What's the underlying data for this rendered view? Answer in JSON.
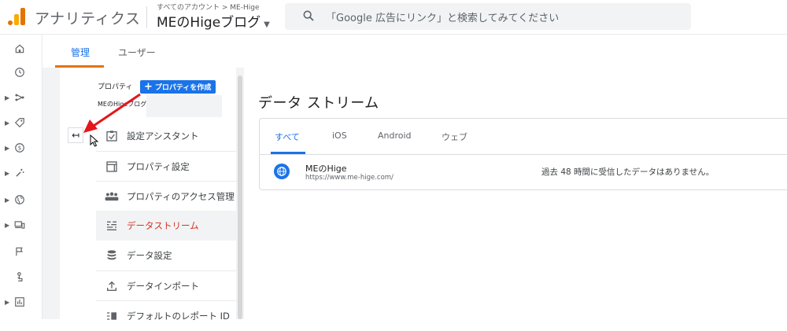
{
  "header": {
    "app_name": "アナリティクス",
    "breadcrumb": "すべてのアカウント > ME-Hige",
    "property_name": "MEのHigeブログ",
    "search_placeholder": "「Google 広告にリンク」と検索してみてください"
  },
  "tabs": [
    {
      "label": "管理"
    },
    {
      "label": "ユーザー"
    }
  ],
  "property_panel": {
    "label": "プロパティ",
    "create_button": "プロパティを作成",
    "property_sub": "MEのHigeブログ"
  },
  "menu": [
    {
      "label": "設定アシスタント"
    },
    {
      "label": "プロパティ設定"
    },
    {
      "label": "プロパティのアクセス管理"
    },
    {
      "label": "データストリーム"
    },
    {
      "label": "データ設定"
    },
    {
      "label": "データインポート"
    },
    {
      "label": "デフォルトのレポート ID"
    }
  ],
  "streams": {
    "title": "データ ストリーム",
    "tabs": [
      "すべて",
      "iOS",
      "Android",
      "ウェブ"
    ],
    "rows": [
      {
        "name": "MEのHige",
        "url": "https://www.me-hige.com/",
        "status": "過去 48 時間に受信したデータはありません。"
      }
    ]
  },
  "colors": {
    "accent_blue": "#1a73e8",
    "active_red": "#d93025",
    "tab_orange": "#e37400"
  }
}
